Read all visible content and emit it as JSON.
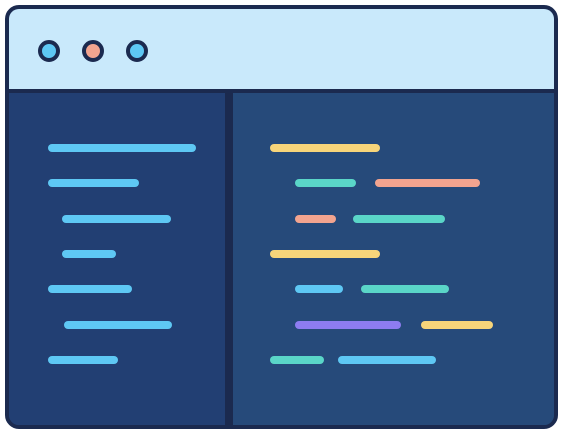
{
  "window": {
    "controls": [
      {
        "name": "window-control-1",
        "color": "#5ec8f4"
      },
      {
        "name": "window-control-2",
        "color": "#f2a48f"
      },
      {
        "name": "window-control-3",
        "color": "#5ec8f4"
      }
    ]
  },
  "colors": {
    "titlebar": "#c9e9fb",
    "frame": "#1b2a4f",
    "sidebar": "#223f73",
    "editor": "#264a7a",
    "blue": "#5ec8f4",
    "yellow": "#f7d57a",
    "teal": "#5ad6c8",
    "salmon": "#f2a48f",
    "purple": "#8d7cf0"
  },
  "sidebar": {
    "lines": [
      "blue",
      "blue",
      "blue",
      "blue",
      "blue",
      "blue",
      "blue"
    ]
  },
  "editor": {
    "lines": [
      [
        "yellow"
      ],
      [
        "teal",
        "salmon"
      ],
      [
        "salmon",
        "teal"
      ],
      [
        "yellow"
      ],
      [
        "blue",
        "teal"
      ],
      [
        "purple",
        "yellow"
      ],
      [
        "teal",
        "blue"
      ]
    ]
  }
}
